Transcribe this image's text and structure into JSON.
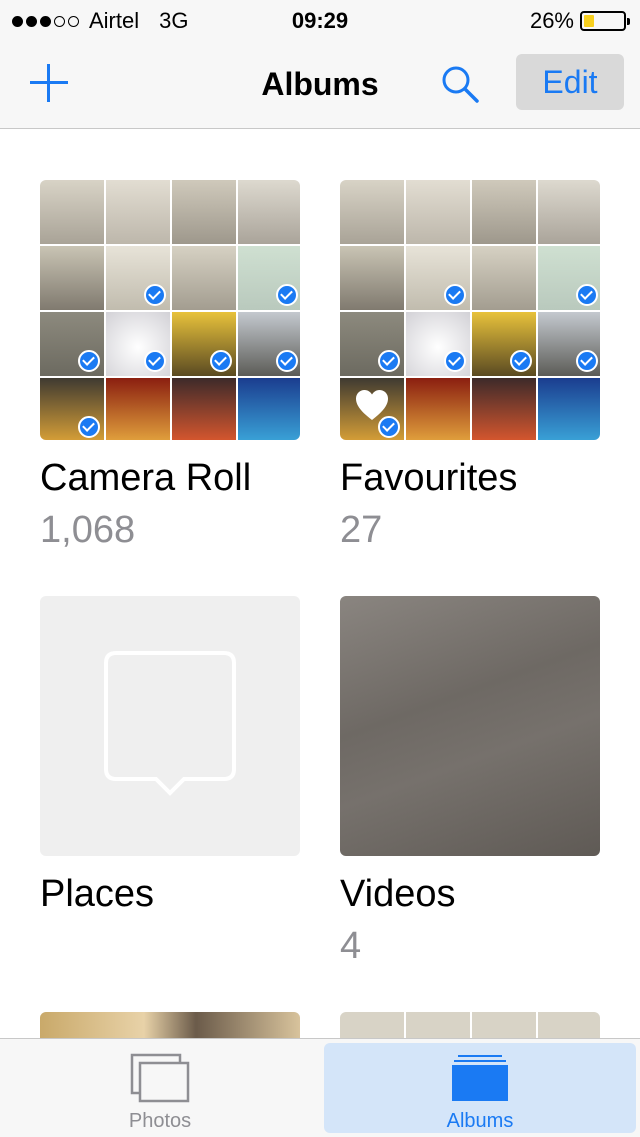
{
  "status_bar": {
    "carrier": "Airtel",
    "network": "3G",
    "time": "09:29",
    "battery_percent": "26%",
    "battery_level": 0.26,
    "signal_bars": 3,
    "signal_total": 5
  },
  "nav": {
    "title": "Albums",
    "edit_label": "Edit"
  },
  "albums": [
    {
      "name": "Camera Roll",
      "count": "1,068"
    },
    {
      "name": "Favourites",
      "count": "27"
    },
    {
      "name": "Places",
      "count": ""
    },
    {
      "name": "Videos",
      "count": "4"
    }
  ],
  "tabs": [
    {
      "label": "Photos",
      "selected": false
    },
    {
      "label": "Albums",
      "selected": true
    }
  ],
  "colors": {
    "accent": "#1a7af3",
    "battery_fill": "#f7cf1e",
    "selected_tab_bg": "#d4e5f9",
    "count_gray": "#8e8e93"
  },
  "icons": [
    "plus-icon",
    "search-icon",
    "heart-icon",
    "check-icon",
    "place-pin-icon",
    "photos-tab-icon",
    "albums-tab-icon"
  ]
}
